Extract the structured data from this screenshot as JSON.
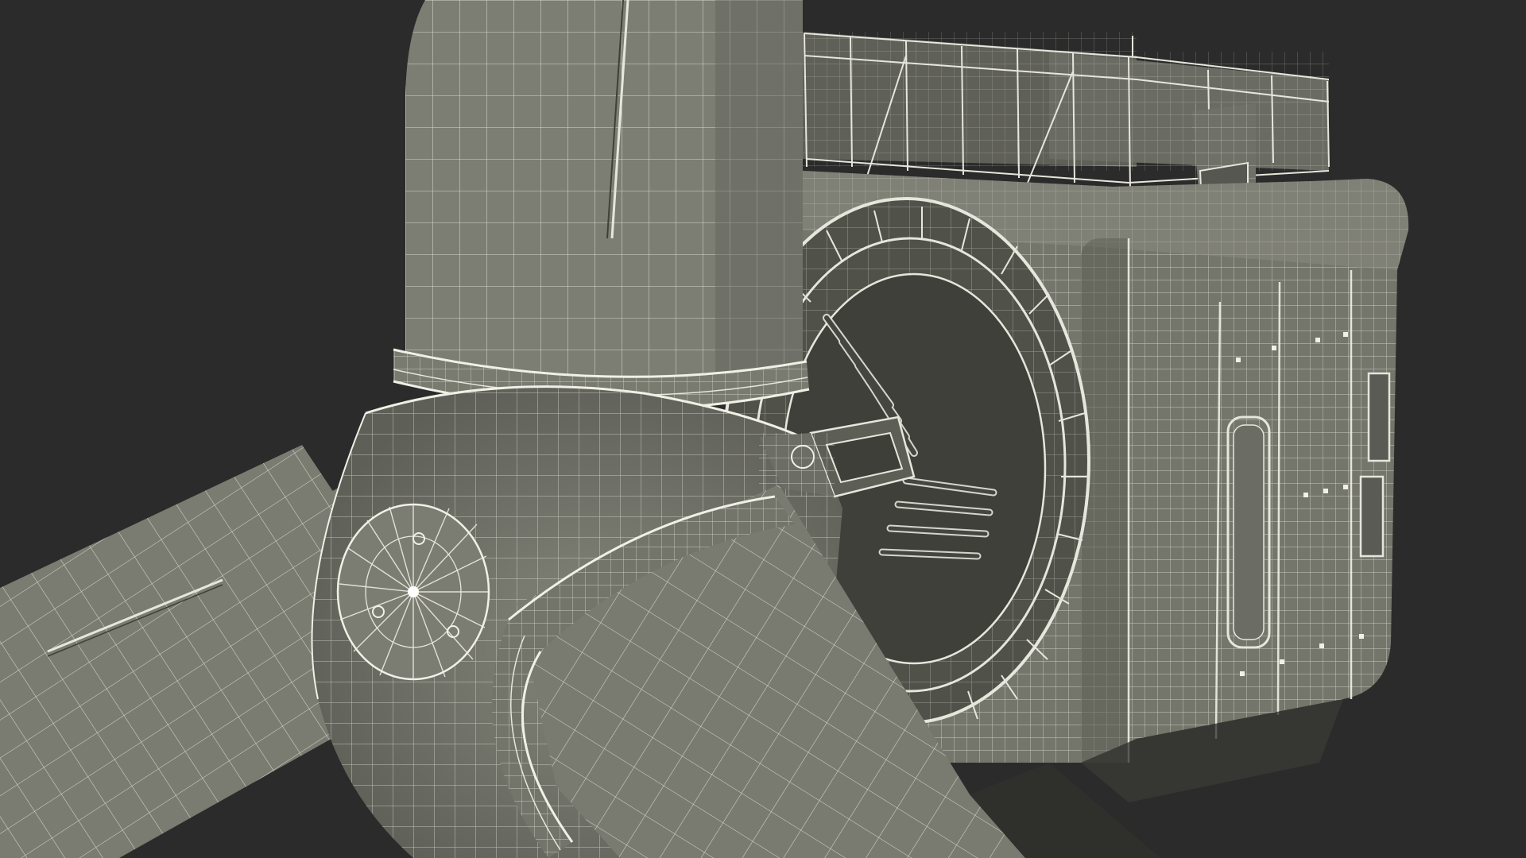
{
  "scene": {
    "subject": "wind-turbine-hub-nacelle-wireframe",
    "background_color": "#2b2b2b",
    "surface_color": "#7a7b70",
    "surface_dark_color": "#5f6058",
    "shadow_color": "#3c3d38",
    "wire_color": "#e6e6dc",
    "view_mode": "wireframe-on-shaded"
  }
}
